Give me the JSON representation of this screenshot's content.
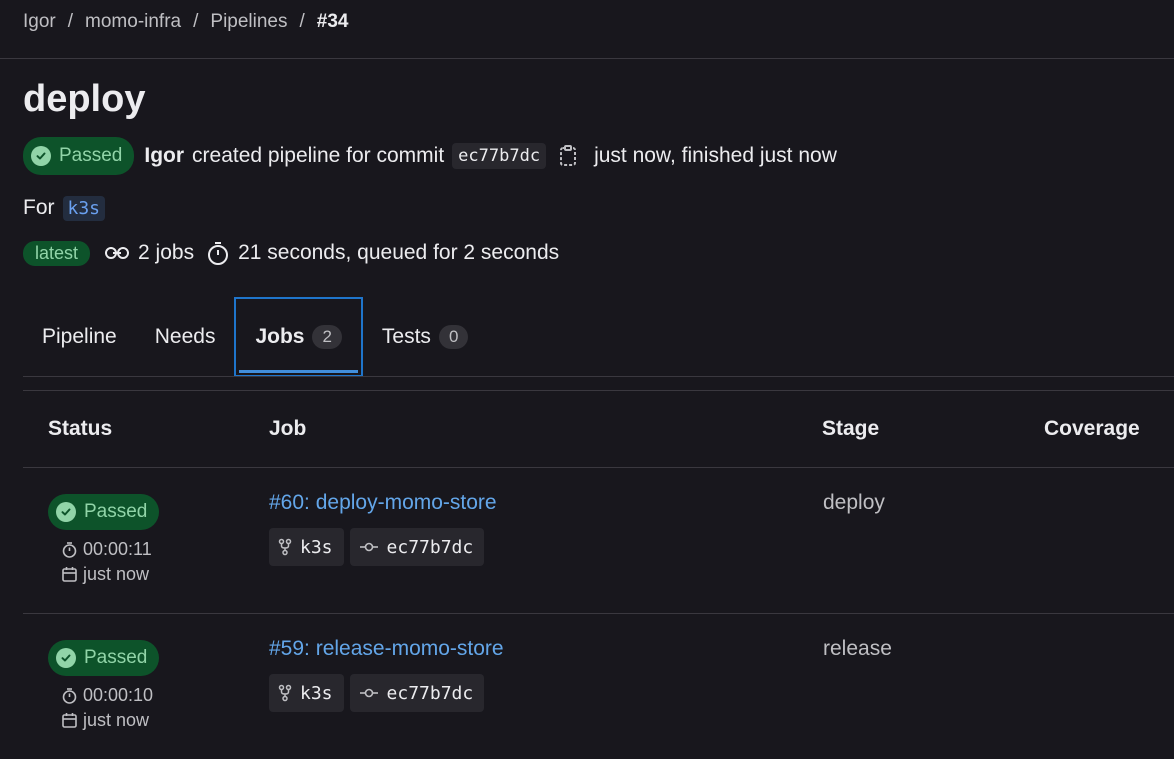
{
  "breadcrumb": [
    "Igor",
    "momo-infra",
    "Pipelines",
    "#34"
  ],
  "title": "deploy",
  "status": {
    "badge": "Passed",
    "user": "Igor",
    "text": "created pipeline for commit",
    "commit": "ec77b7dc",
    "time_text": "just now, finished just now"
  },
  "for_line": {
    "label": "For",
    "ref": "k3s"
  },
  "meta": {
    "latest": "latest",
    "jobs": "2 jobs",
    "duration": "21 seconds, queued for 2 seconds"
  },
  "tabs": [
    {
      "label": "Pipeline",
      "count": null,
      "active": false
    },
    {
      "label": "Needs",
      "count": null,
      "active": false
    },
    {
      "label": "Jobs",
      "count": "2",
      "active": true
    },
    {
      "label": "Tests",
      "count": "0",
      "active": false
    }
  ],
  "table": {
    "headers": {
      "status": "Status",
      "job": "Job",
      "stage": "Stage",
      "coverage": "Coverage"
    },
    "rows": [
      {
        "status": "Passed",
        "duration": "00:00:11",
        "finished": "just now",
        "job": "#60: deploy-momo-store",
        "ref": "k3s",
        "commit": "ec77b7dc",
        "stage": "deploy"
      },
      {
        "status": "Passed",
        "duration": "00:00:10",
        "finished": "just now",
        "job": "#59: release-momo-store",
        "ref": "k3s",
        "commit": "ec77b7dc",
        "stage": "release"
      }
    ]
  },
  "colors": {
    "background": "#18171d",
    "success": "#91d4a8",
    "link": "#63a6e9",
    "active_tab": "#1f75cb"
  }
}
